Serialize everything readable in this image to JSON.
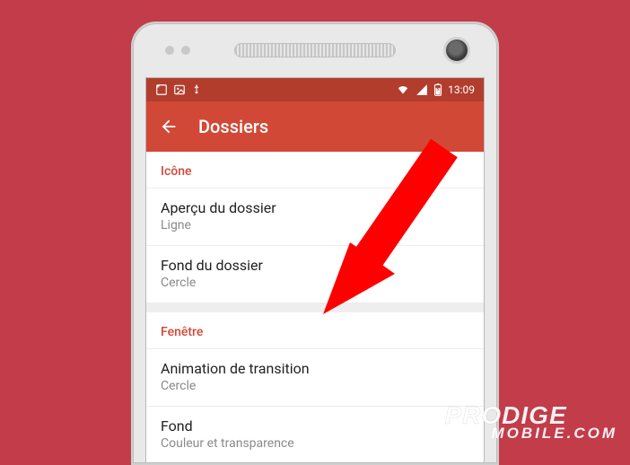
{
  "statusbar": {
    "time": "13:09"
  },
  "appbar": {
    "title": "Dossiers"
  },
  "sections": {
    "icone": {
      "header": "Icône",
      "item0": {
        "title": "Aperçu du dossier",
        "subtitle": "Ligne"
      },
      "item1": {
        "title": "Fond du dossier",
        "subtitle": "Cercle"
      }
    },
    "fenetre": {
      "header": "Fenêtre",
      "item0": {
        "title": "Animation de transition",
        "subtitle": "Cercle"
      },
      "item1": {
        "title": "Fond",
        "subtitle": "Couleur et transparence"
      }
    }
  },
  "watermark": {
    "line1": "PRODIGE",
    "line2": "MOBILE.COM"
  }
}
